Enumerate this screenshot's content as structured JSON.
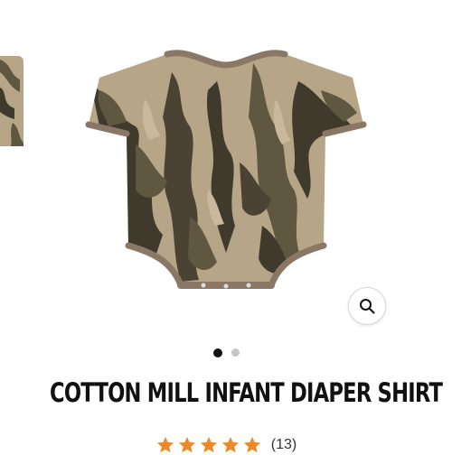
{
  "product": {
    "title": "COTTON MILL INFANT DIAPER SHIRT",
    "rating": 5,
    "review_count": "(13)"
  },
  "gallery": {
    "slide_count": 2,
    "active_slide": 1,
    "zoom_icon": "magnifier-icon"
  },
  "colors": {
    "star": "#e98b2a",
    "camo_base": "#b7a588",
    "camo_dark": "#3f3a2c",
    "camo_mid": "#5f5740",
    "trim": "#8a7765"
  }
}
